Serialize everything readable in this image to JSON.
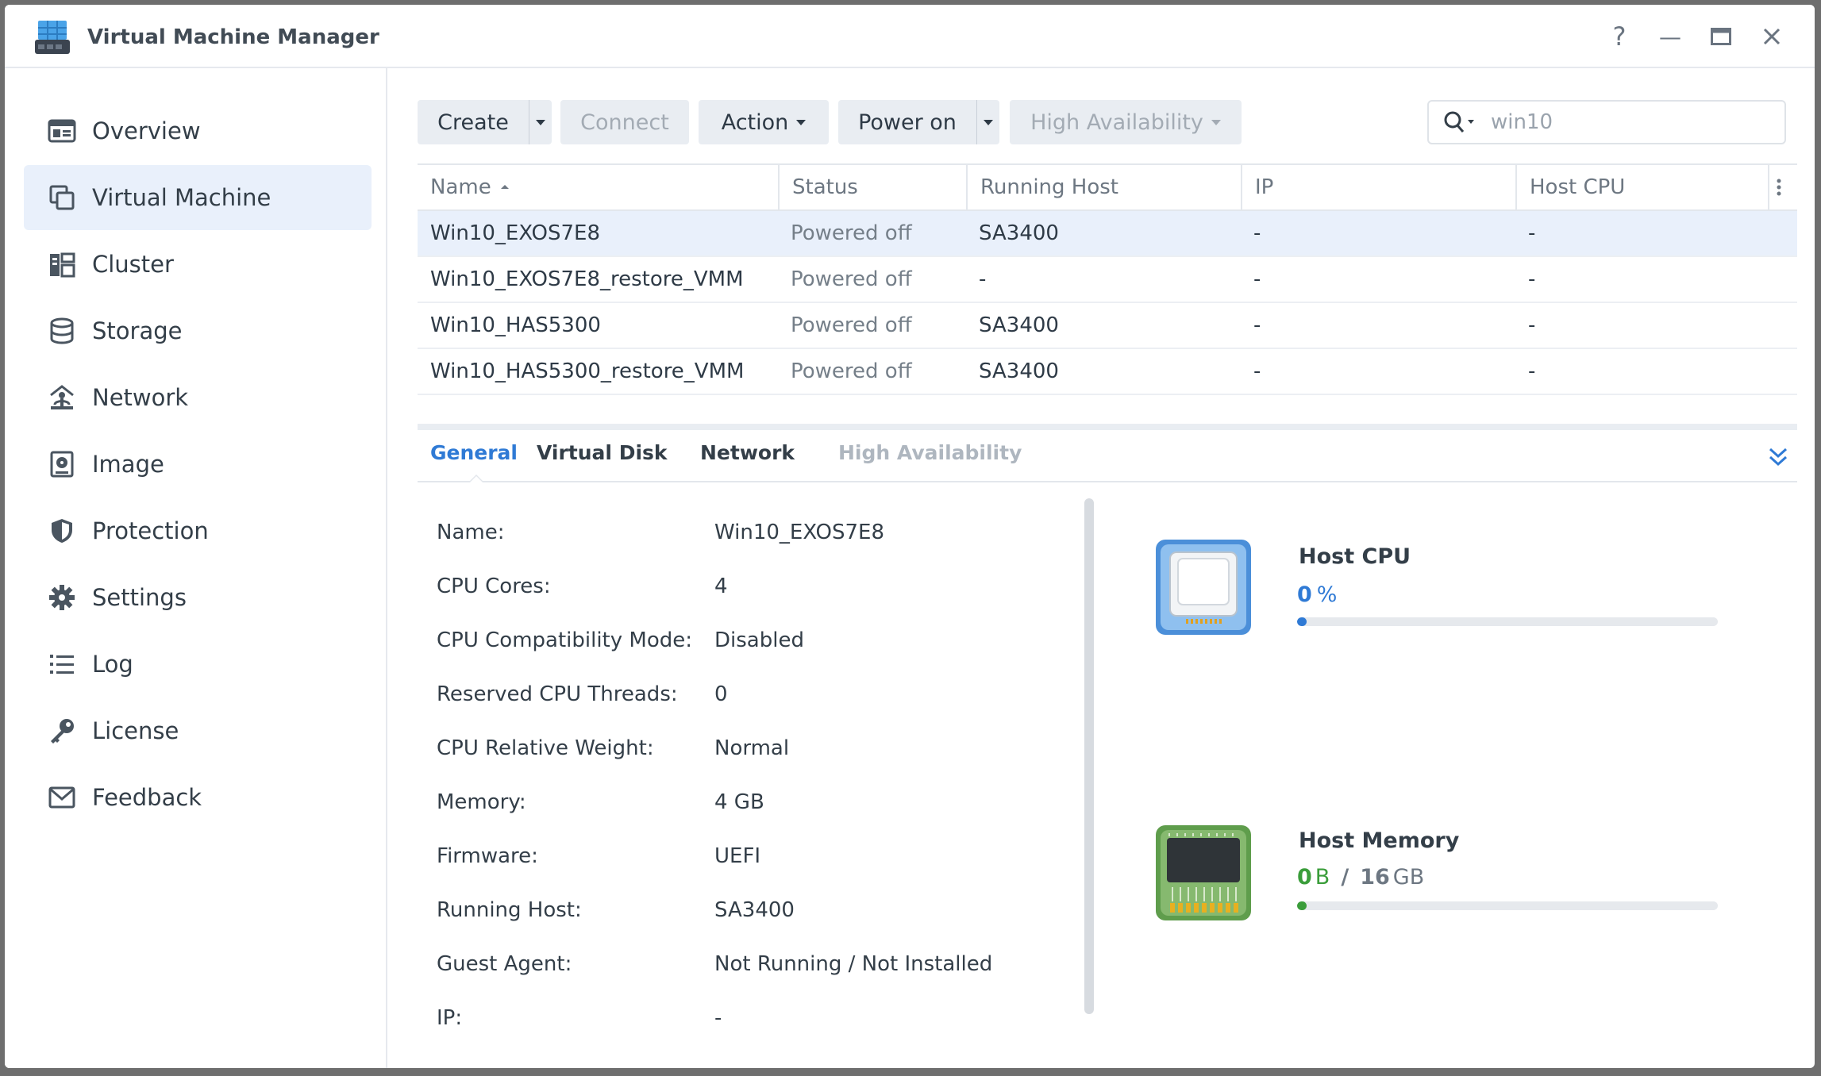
{
  "app": {
    "title": "Virtual Machine Manager"
  },
  "window_controls": {
    "help": "?",
    "minimize": "—",
    "maximize": "▭",
    "close": "✕"
  },
  "sidebar": {
    "items": [
      {
        "label": "Overview",
        "icon": "overview-icon"
      },
      {
        "label": "Virtual Machine",
        "icon": "virtual-machine-icon",
        "active": true
      },
      {
        "label": "Cluster",
        "icon": "cluster-icon"
      },
      {
        "label": "Storage",
        "icon": "storage-icon"
      },
      {
        "label": "Network",
        "icon": "network-icon"
      },
      {
        "label": "Image",
        "icon": "image-icon"
      },
      {
        "label": "Protection",
        "icon": "shield-icon"
      },
      {
        "label": "Settings",
        "icon": "gear-icon"
      },
      {
        "label": "Log",
        "icon": "list-icon"
      },
      {
        "label": "License",
        "icon": "key-icon"
      },
      {
        "label": "Feedback",
        "icon": "mail-icon"
      }
    ]
  },
  "toolbar": {
    "create": "Create",
    "connect": "Connect",
    "action": "Action",
    "power_on": "Power on",
    "high_availability": "High Availability",
    "search_value": "win10"
  },
  "table": {
    "columns": [
      "Name",
      "Status",
      "Running Host",
      "IP",
      "Host CPU"
    ],
    "rows": [
      {
        "name": "Win10_EXOS7E8",
        "status": "Powered off",
        "host": "SA3400",
        "ip": "-",
        "cpu": "-"
      },
      {
        "name": "Win10_EXOS7E8_restore_VMM",
        "status": "Powered off",
        "host": "-",
        "ip": "-",
        "cpu": "-"
      },
      {
        "name": "Win10_HAS5300",
        "status": "Powered off",
        "host": "SA3400",
        "ip": "-",
        "cpu": "-"
      },
      {
        "name": "Win10_HAS5300_restore_VMM",
        "status": "Powered off",
        "host": "SA3400",
        "ip": "-",
        "cpu": "-"
      }
    ]
  },
  "details": {
    "tabs": [
      "General",
      "Virtual Disk",
      "Network",
      "High Availability"
    ],
    "properties": [
      {
        "label": "Name:",
        "value": "Win10_EXOS7E8"
      },
      {
        "label": "CPU Cores:",
        "value": "4"
      },
      {
        "label": "CPU Compatibility Mode:",
        "value": "Disabled"
      },
      {
        "label": "Reserved CPU Threads:",
        "value": "0"
      },
      {
        "label": "CPU Relative Weight:",
        "value": "Normal"
      },
      {
        "label": "Memory:",
        "value": "4 GB"
      },
      {
        "label": "Firmware:",
        "value": "UEFI"
      },
      {
        "label": "Running Host:",
        "value": "SA3400"
      },
      {
        "label": "Guest Agent:",
        "value": "Not Running / Not Installed"
      },
      {
        "label": "IP:",
        "value": "-"
      }
    ],
    "host_cpu": {
      "title": "Host CPU",
      "value": "0",
      "unit": "%",
      "fraction": 0.0
    },
    "host_memory": {
      "title": "Host Memory",
      "used": "0",
      "used_unit": "B",
      "sep": "/",
      "total": "16",
      "total_unit": "GB",
      "fraction": 0.0
    }
  },
  "colors": {
    "accent": "#2f7ad5",
    "memory_green": "#3a9d3a",
    "selected_row": "#e9f0fb"
  }
}
